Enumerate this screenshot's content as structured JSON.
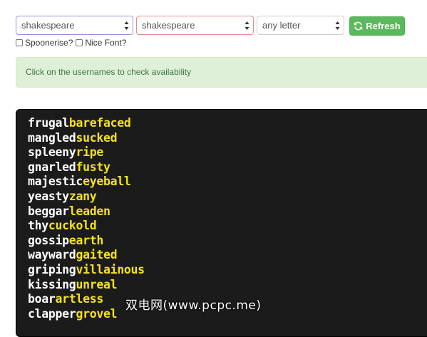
{
  "controls": {
    "select1": {
      "value": "shakespeare"
    },
    "select2": {
      "value": "shakespeare"
    },
    "select3": {
      "value": "any letter"
    },
    "refresh_label": "Refresh"
  },
  "options": {
    "spoonerise_label": "Spoonerise?",
    "nice_font_label": "Nice Font?"
  },
  "alert": {
    "text": "Click on the usernames to check availability"
  },
  "usernames": [
    {
      "first": "frugal",
      "second": "barefaced"
    },
    {
      "first": "mangled",
      "second": "sucked"
    },
    {
      "first": "spleeny",
      "second": "ripe"
    },
    {
      "first": "gnarled",
      "second": "fusty"
    },
    {
      "first": "majestic",
      "second": "eyeball"
    },
    {
      "first": "yeasty",
      "second": "zany"
    },
    {
      "first": "beggar",
      "second": "leaden"
    },
    {
      "first": "thy",
      "second": "cuckold"
    },
    {
      "first": "gossip",
      "second": "earth"
    },
    {
      "first": "wayward",
      "second": "gaited"
    },
    {
      "first": "griping",
      "second": "villainous"
    },
    {
      "first": "kissing",
      "second": "unreal"
    },
    {
      "first": "boar",
      "second": "artless"
    },
    {
      "first": "clapper",
      "second": "grovel"
    }
  ],
  "watermark": "双电网(www.pcpc.me)",
  "colors": {
    "terminal_bg": "#1b1b1b",
    "first_word": "#ffffff",
    "second_word": "#f4e21c",
    "refresh_button": "#5cb85c",
    "alert_bg": "#dff0d8",
    "alert_text": "#3c763d"
  }
}
